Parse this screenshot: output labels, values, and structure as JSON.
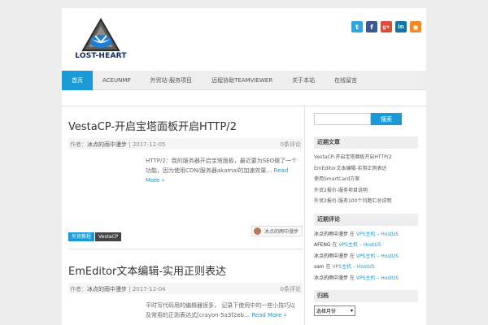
{
  "logo": {
    "text": "LOST-HEART"
  },
  "social": [
    {
      "icon": "twitter-icon",
      "glyph": "t",
      "color": "#2fa7e0"
    },
    {
      "icon": "facebook-icon",
      "glyph": "f",
      "color": "#3b5998"
    },
    {
      "icon": "google-plus-icon",
      "glyph": "g+",
      "color": "#dd4b39"
    },
    {
      "icon": "linkedin-icon",
      "glyph": "in",
      "color": "#0e76a8"
    },
    {
      "icon": "rss-icon",
      "glyph": "◉",
      "color": "#f58a22"
    }
  ],
  "nav": [
    {
      "label": "首页",
      "active": true
    },
    {
      "label": "ACEUNMP"
    },
    {
      "label": "外贸站-服务项目"
    },
    {
      "label": "远程协助TEAMVIEWER"
    },
    {
      "label": "关于本站"
    },
    {
      "label": "在线留言"
    }
  ],
  "posts": [
    {
      "title": "VestaCP-开启宝塔面板开启HTTP/2",
      "author_label": "作者：",
      "author": "冰点的雨中漫步",
      "date": "2017-12-05",
      "comments": "0条评论",
      "excerpt": "HTTP/2：我的服务器开启宝塔面板，最近要为SEO做了一个功能，因为使用CDN/服务器akamai的加速效果…",
      "read_more": "Read More »",
      "tags": [
        "外贸教程",
        "VestaCP"
      ],
      "avatar_name": "冰点的雨中漫步"
    },
    {
      "title": "EmEditor文本编辑-实用正则表达",
      "author_label": "作者：",
      "author": "冰点的雨中漫步",
      "date": "2017-12-04",
      "comments": "0条评论",
      "excerpt": "平时写代码用的编辑器很多， 记录下使用中的一些小技巧以及常用的正则表达式[crayon-5a3f2eb…",
      "read_more": "Read More »"
    }
  ],
  "sidebar": {
    "search_placeholder": "",
    "search_button": "搜索",
    "recent_title": "近期文章",
    "recent": [
      "VestaCP-开启宝塔面板开启HTTP/2",
      "EmEditor文本编辑-实用正则表达",
      "使用SmartCard方案",
      "外贸2报价-服务项目说明",
      "外贸2报价-服务100个问题汇总说明"
    ],
    "comments_title": "近期评论",
    "comments": [
      {
        "author": "冰点的雨中漫步",
        "on": "在",
        "post": "VPS主机 – HostUS"
      },
      {
        "author": "AFENG",
        "on": "在",
        "post": "VPS主机 – HostUS"
      },
      {
        "author": "冰点的雨中漫步",
        "on": "在",
        "post": "VPS主机 – HostUS"
      },
      {
        "author": "sam",
        "on": "在",
        "post": "VPS主机 – HostUS"
      },
      {
        "author": "冰点的雨中漫步",
        "on": "在",
        "post": "VPS主机 – HostUS"
      }
    ],
    "archive_title": "归档",
    "archive_select": "选择月份"
  }
}
